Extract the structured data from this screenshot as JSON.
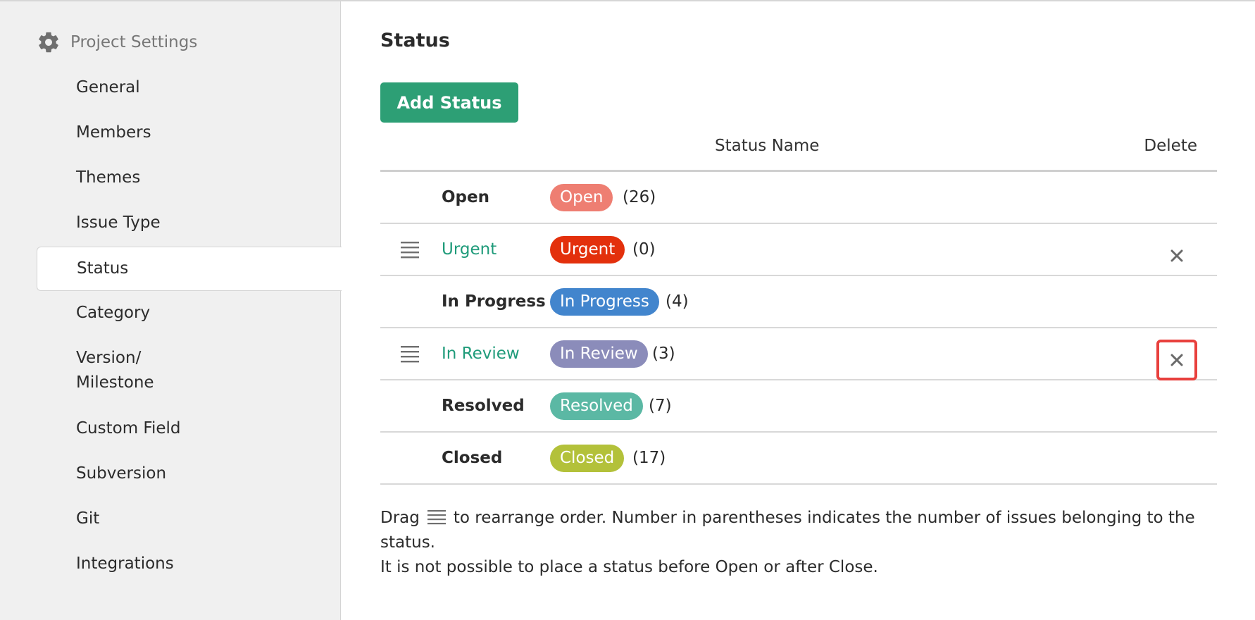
{
  "sidebar": {
    "title": "Project Settings",
    "header_icon": "gear-icon",
    "items": [
      {
        "label": "General"
      },
      {
        "label": "Members"
      },
      {
        "label": "Themes"
      },
      {
        "label": "Issue Type"
      },
      {
        "label": "Status",
        "active": true
      },
      {
        "label": "Category"
      },
      {
        "label": "Version/\nMilestone"
      },
      {
        "label": "Custom Field"
      },
      {
        "label": "Subversion"
      },
      {
        "label": "Git"
      },
      {
        "label": "Integrations"
      }
    ]
  },
  "main": {
    "title": "Status",
    "add_button": "Add Status",
    "columns": {
      "name": "Status Name",
      "delete": "Delete"
    },
    "statuses": [
      {
        "name": "Open",
        "badge": "Open",
        "count": "(26)",
        "color": "#ee7e72",
        "editable": false,
        "deletable": false
      },
      {
        "name": "Urgent",
        "badge": "Urgent",
        "count": "(0)",
        "color": "#e3300c",
        "editable": true,
        "deletable": true
      },
      {
        "name": "In Progress",
        "badge": "In Progress",
        "count": "(4)",
        "color": "#4285cd",
        "editable": false,
        "deletable": false
      },
      {
        "name": "In Review",
        "badge": "In Review",
        "count": "(3)",
        "color": "#8b8cba",
        "editable": true,
        "deletable": true,
        "highlighted": true
      },
      {
        "name": "Resolved",
        "badge": "Resolved",
        "count": "(7)",
        "color": "#5bb8a4",
        "editable": false,
        "deletable": false
      },
      {
        "name": "Closed",
        "badge": "Closed",
        "count": "(17)",
        "color": "#b3c13a",
        "editable": false,
        "deletable": false
      }
    ],
    "note": {
      "part1": "Drag",
      "part2": "to rearrange order. Number in parentheses indicates the number of issues belonging to the status.",
      "line2": "It is not possible to place a status before Open or after Close."
    }
  },
  "colors": {
    "accent": "#2d9f75",
    "link": "#1f9b7a",
    "highlight": "#e8403d"
  }
}
